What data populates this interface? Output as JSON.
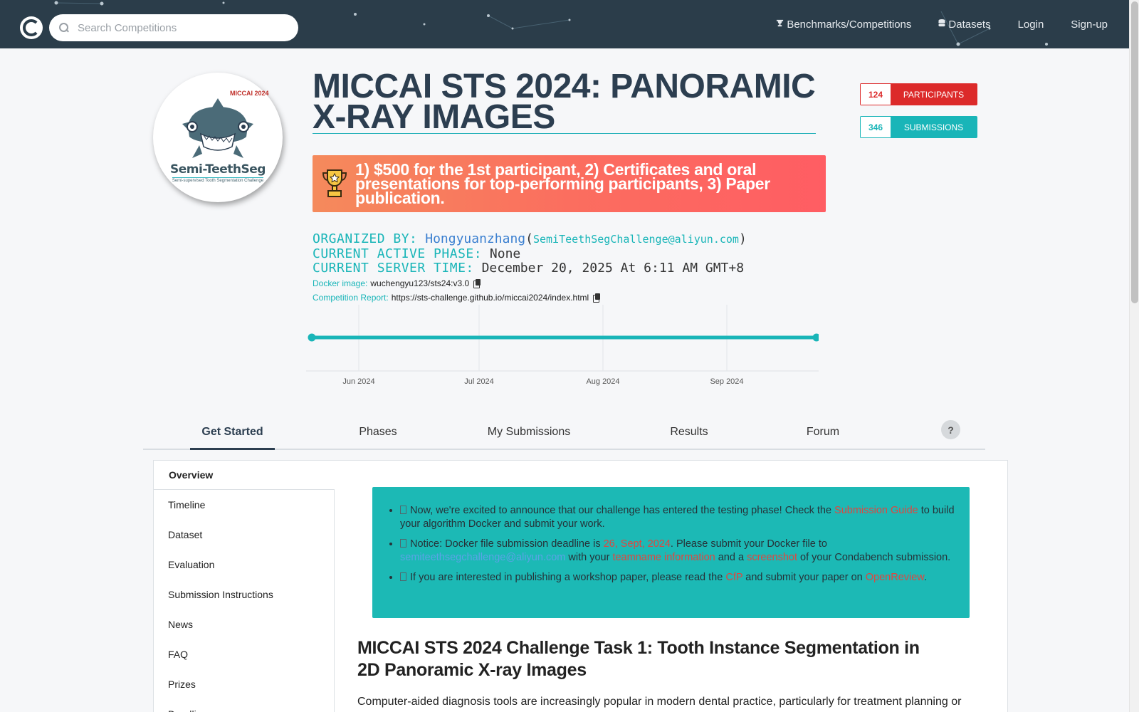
{
  "nav": {
    "search_placeholder": "Search Competitions",
    "links": [
      {
        "label": "Benchmarks/Competitions",
        "icon": "trophy-icon"
      },
      {
        "label": "Datasets",
        "icon": "database-icon"
      },
      {
        "label": "Login"
      },
      {
        "label": "Sign-up"
      }
    ]
  },
  "competition": {
    "logo_brand": "Semi-TeethSeg",
    "logo_subtitle": "Semi-supervised Tooth Segmentation Challenge",
    "logo_event": "MICCAI 2024",
    "title": "MICCAI STS 2024: PANORAMIC X-RAY IMAGES",
    "prize": "1) $500 for the 1st participant, 2) Certificates and oral presentations for top-performing participants, 3) Paper publication.",
    "participants_count": "124",
    "participants_label": "PARTICIPANTS",
    "submissions_count": "346",
    "submissions_label": "SUBMISSIONS"
  },
  "info": {
    "organized_label": "ORGANIZED BY:",
    "organizer": "Hongyuanzhang",
    "email": "SemiTeethSegChallenge@aliyun.com",
    "phase_label": "CURRENT ACTIVE PHASE:",
    "phase_value": "None",
    "time_label": "CURRENT SERVER TIME:",
    "time_value": "December 20, 2025 At 6:11 AM GMT+8",
    "docker_label": "Docker image:",
    "docker_value": "wuchengyu123/sts24:v3.0",
    "report_label": "Competition Report:",
    "report_value": "https://sts-challenge.github.io/miccai2024/index.html"
  },
  "timeline": {
    "ticks": [
      "Jun 2024",
      "Jul 2024",
      "Aug 2024",
      "Sep 2024"
    ],
    "color": "#19b5b8"
  },
  "tabs": [
    "Get Started",
    "Phases",
    "My Submissions",
    "Results",
    "Forum"
  ],
  "help_label": "?",
  "sidebar": [
    "Overview",
    "Timeline",
    "Dataset",
    "Evaluation",
    "Submission Instructions",
    "News",
    "FAQ",
    "Prizes",
    "Deadlines"
  ],
  "notice": {
    "item1": {
      "a": "Now, we're excited to announce that our challenge has entered the testing phase! Check the ",
      "link": "Submission Guide",
      "b": " to build your algorithm Docker and submit your work."
    },
    "item2": {
      "a": "Notice: Docker file submission deadline is ",
      "date": "26, Sept, 2024",
      "b": ". Please submit your Docker file to ",
      "email": "semiteethsegchallenge@aliyun.com",
      "c": " with your ",
      "link1": "teamname information",
      "d": " and a ",
      "link2": "screenshot",
      "e": " of your Condabench submission."
    },
    "item3": {
      "a": "If you are interested in publishing a workshop paper, please read the ",
      "link1": "CfP",
      "b": " and submit your paper on ",
      "link2": "OpenReview",
      "c": "."
    }
  },
  "section": {
    "title": "MICCAI STS 2024 Challenge Task 1: Tooth Instance Segmentation in 2D Panoramic X-ray Images",
    "body": "Computer-aided diagnosis tools are increasingly popular in modern dental practice, particularly for treatment planning or"
  }
}
